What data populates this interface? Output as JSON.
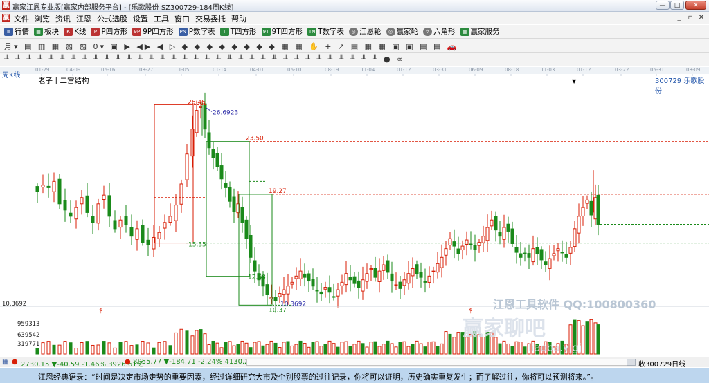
{
  "window": {
    "title": "赢家江恩专业版[赢家内部服务平台] - [乐歌股份  SZ300729-184周K线]",
    "app_icon": "赢",
    "buttons": {
      "minimize": "—",
      "maximize": "□",
      "close": "✕"
    }
  },
  "menu": {
    "icon": "赢",
    "items": [
      "文件",
      "浏览",
      "资讯",
      "江恩",
      "公式选股",
      "设置",
      "工具",
      "窗口",
      "交易委托",
      "帮助"
    ],
    "right": {
      "minimize": "_",
      "restore": "▫",
      "close": "✕"
    }
  },
  "toolbar1": {
    "items": [
      {
        "icon": "≡",
        "label": "行情"
      },
      {
        "icon": "▦",
        "label": "板块"
      },
      {
        "icon": "K",
        "label": "K线"
      },
      {
        "icon": "P",
        "label": "P四方形"
      },
      {
        "icon": "9P",
        "label": "9P四方形"
      },
      {
        "icon": "PN",
        "label": "P数字表"
      },
      {
        "icon": "T",
        "label": "T四方形"
      },
      {
        "icon": "9T",
        "label": "9T四方形"
      },
      {
        "icon": "TN",
        "label": "T数字表"
      },
      {
        "icon": "◎",
        "label": "江恩轮"
      },
      {
        "icon": "◎",
        "label": "赢家轮"
      },
      {
        "icon": "✡",
        "label": "六角形"
      },
      {
        "icon": "▦",
        "label": "赢家服务"
      }
    ]
  },
  "toolbar2": {
    "text": "月▾ ▤ ▥ ▦ ▧ ▨ 0▾ ▣ ▶ ◀▶ ◀ ▷ ◆ ◆ ◆ ◆ ◆ ◆ ◆ ◆ ▦ ▦ ✋ + ↗ ▤ ▦ ▦ ▣ ▣ ▤ ▤ 🚗"
  },
  "toolbar3": {
    "text": "╨ ╨ ╨ ╨ ╨ ╨ ╨ ╨ ╨ ╨ ╨ ╨ ╨ ╨ ╨ ╨ ╨ ╨ ╨ ╨ ╨ ╨ ╨ ╨ ╨ ╨ ╨ ╨ ╨ ╨ ╨ ╨ ╨ ╨ ● ∞"
  },
  "date_axis": [
    "01-29",
    "04-09",
    "06-16",
    "08-27",
    "11-05",
    "01-14",
    "04-01",
    "06-10",
    "08-19",
    "11-04",
    "01-12",
    "03-31",
    "06-09",
    "08-18",
    "11-03",
    "01-12",
    "03-22",
    "05-31",
    "08-09"
  ],
  "period_label": "周K线",
  "indicator_name": "老子十二宫结构",
  "dropdown_arrow": "▼",
  "stock_code_label": "300729  乐歌股份",
  "watermark": {
    "line1": "江恩工具软件  QQ:100800360",
    "line2": "赢家聊吧",
    "line3": "liaoba.yjgj"
  },
  "status": {
    "sh_index": "2730.15 ▼-40.59 -1.46% 3926.61亿",
    "sz_index": "8055.77 ▼-184.71 -2.24% 4130.2",
    "right_label": "收300729日线"
  },
  "footer_quote": "江恩经典语录：“时间是决定市场走势的重要因素，经过详细研究大市及个别股票的过往记录，你将可以证明，历史确实重复发生；而了解过往，你将可以预测将来。”。",
  "colors": {
    "up": "#d81e06",
    "down": "#1a8a1a",
    "accent": "#2255aa"
  },
  "chart_data": {
    "type": "candlestick",
    "price_labels": [
      {
        "text": "26.46",
        "color": "#d81e06"
      },
      {
        "text": "26.6923",
        "color": "#3333aa"
      },
      {
        "text": "23.50",
        "color": "#d81e06"
      },
      {
        "text": "19.27",
        "color": "#d81e06"
      },
      {
        "text": "15.35",
        "color": "#1a8a1a"
      },
      {
        "text": "12.68",
        "color": "#1a8a1a"
      },
      {
        "text": "10.37",
        "color": "#1a8a1a"
      },
      {
        "text": "10.3692",
        "color": "#3333aa"
      }
    ],
    "left_axis": [
      "10.3692",
      "959313",
      "639542",
      "319771"
    ],
    "dollar_marks": [
      "$",
      "$"
    ],
    "reference_levels": [
      26.46,
      23.5,
      19.27,
      15.35,
      12.68,
      10.37
    ],
    "ylim": [
      9.5,
      28.2
    ]
  }
}
